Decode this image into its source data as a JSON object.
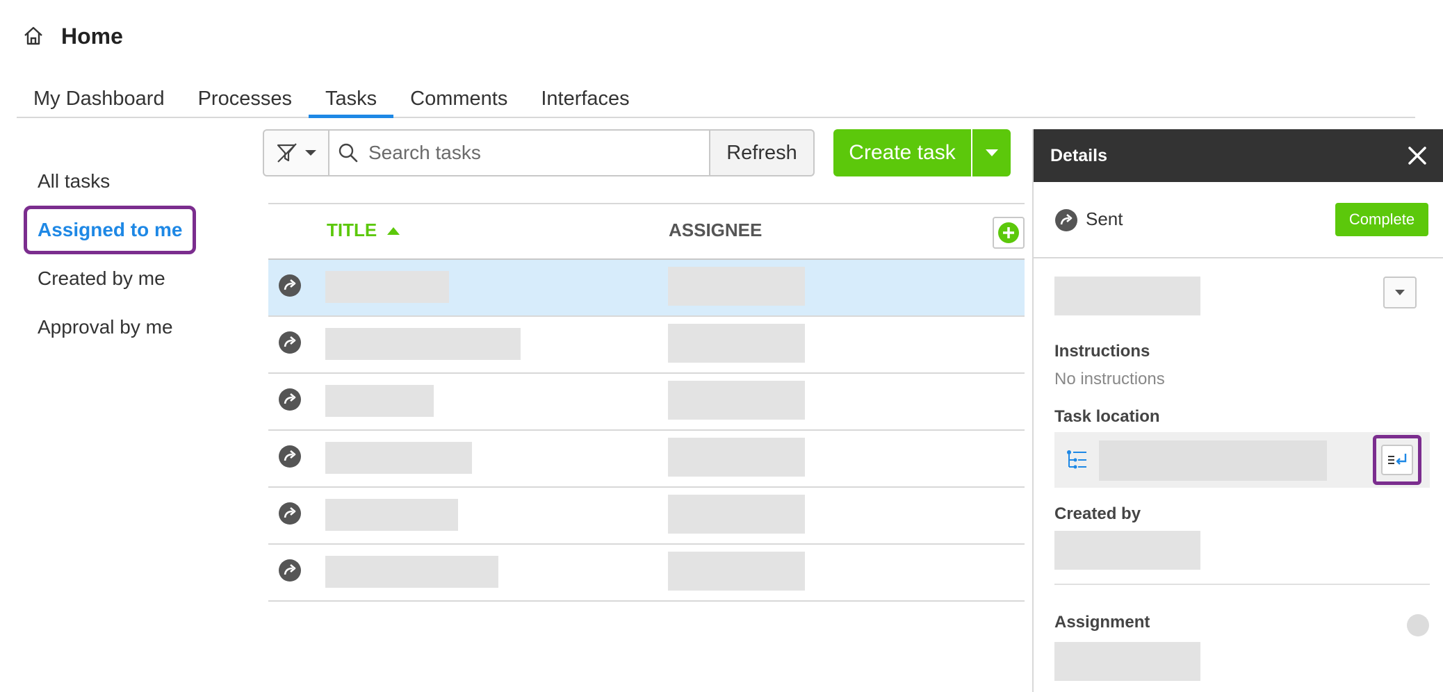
{
  "header": {
    "title": "Home",
    "icon": "home-icon"
  },
  "tabs": [
    {
      "label": "My Dashboard",
      "active": false
    },
    {
      "label": "Processes",
      "active": false
    },
    {
      "label": "Tasks",
      "active": true
    },
    {
      "label": "Comments",
      "active": false
    },
    {
      "label": "Interfaces",
      "active": false
    }
  ],
  "sidebar": {
    "items": [
      {
        "label": "All tasks",
        "active": false
      },
      {
        "label": "Assigned to me",
        "active": true
      },
      {
        "label": "Created by me",
        "active": false
      },
      {
        "label": "Approval by me",
        "active": false
      }
    ]
  },
  "toolbar": {
    "filter_icon": "filter-off-icon",
    "search_placeholder": "Search tasks",
    "refresh_label": "Refresh",
    "create_label": "Create task"
  },
  "table": {
    "columns": {
      "title": "TITLE",
      "assignee": "ASSIGNEE"
    },
    "sort": "title-ascending",
    "rows": [
      {
        "status_icon": "sent-icon",
        "selected": true
      },
      {
        "status_icon": "sent-icon",
        "selected": false
      },
      {
        "status_icon": "sent-icon",
        "selected": false
      },
      {
        "status_icon": "sent-icon",
        "selected": false
      },
      {
        "status_icon": "sent-icon",
        "selected": false
      },
      {
        "status_icon": "sent-icon",
        "selected": false
      }
    ]
  },
  "details": {
    "title": "Details",
    "status": "Sent",
    "complete_label": "Complete",
    "instructions_label": "Instructions",
    "instructions_value": "No instructions",
    "task_location_label": "Task location",
    "created_by_label": "Created by",
    "assignment_label": "Assignment"
  },
  "colors": {
    "accent_green": "#5cc80b",
    "accent_blue": "#1e88e5",
    "highlight_purple": "#7b2d8e",
    "selected_row": "#d7ecfb",
    "panel_header": "#333333"
  }
}
